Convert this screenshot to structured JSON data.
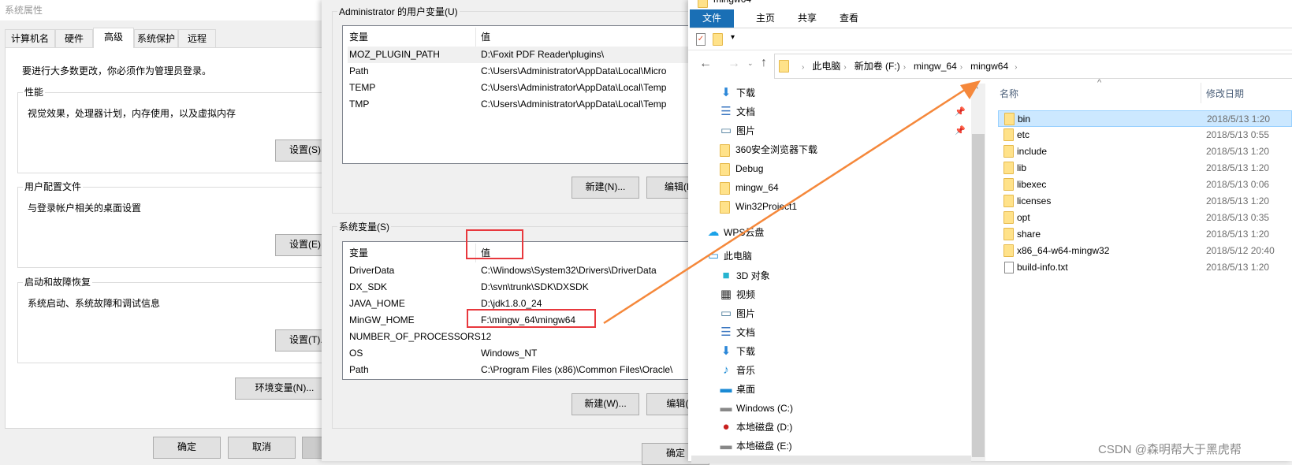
{
  "sys_props": {
    "title": "系统属性",
    "tabs": [
      {
        "label": "计算机名"
      },
      {
        "label": "硬件"
      },
      {
        "label": "高级",
        "active": true
      },
      {
        "label": "系统保护"
      },
      {
        "label": "远程"
      }
    ],
    "admin_note": "要进行大多数更改，你必须作为管理员登录。",
    "groups": [
      {
        "title": "性能",
        "desc": "视觉效果，处理器计划，内存使用，以及虚拟内存",
        "button": "设置(S)..."
      },
      {
        "title": "用户配置文件",
        "desc": "与登录帐户相关的桌面设置",
        "button": "设置(E)..."
      },
      {
        "title": "启动和故障恢复",
        "desc": "系统启动、系统故障和调试信息",
        "button": "设置(T)..."
      }
    ],
    "env_button": "环境变量(N)...",
    "ok": "确定",
    "cancel": "取消"
  },
  "env_vars": {
    "user_group": "Administrator 的用户变量(U)",
    "col_var": "变量",
    "col_val": "值",
    "user_rows": [
      {
        "name": "MOZ_PLUGIN_PATH",
        "value": "D:\\Foxit PDF Reader\\plugins\\"
      },
      {
        "name": "Path",
        "value": "C:\\Users\\Administrator\\AppData\\Local\\Micro"
      },
      {
        "name": "TEMP",
        "value": "C:\\Users\\Administrator\\AppData\\Local\\Temp"
      },
      {
        "name": "TMP",
        "value": "C:\\Users\\Administrator\\AppData\\Local\\Temp"
      }
    ],
    "user_new": "新建(N)...",
    "user_edit": "编辑(E)",
    "sys_group": "系统变量(S)",
    "sys_rows": [
      {
        "name": "DriverData",
        "value": "C:\\Windows\\System32\\Drivers\\DriverData"
      },
      {
        "name": "DX_SDK",
        "value": "D:\\svn\\trunk\\SDK\\DXSDK"
      },
      {
        "name": "JAVA_HOME",
        "value": "D:\\jdk1.8.0_24"
      },
      {
        "name": "MinGW_HOME",
        "value": "F:\\mingw_64\\mingw64"
      },
      {
        "name": "NUMBER_OF_PROCESSORS",
        "value": "12"
      },
      {
        "name": "OS",
        "value": "Windows_NT"
      },
      {
        "name": "Path",
        "value": "C:\\Program Files (x86)\\Common Files\\Oracle\\"
      }
    ],
    "sys_new": "新建(W)...",
    "sys_edit": "编辑(I)",
    "ok": "确定",
    "highlight_color": "#e8383d",
    "arrow_color": "#f5883b"
  },
  "explorer": {
    "title": "mingw64",
    "ribbon_tabs": [
      "文件",
      "主页",
      "共享",
      "查看"
    ],
    "accent": "#1a6fb5",
    "breadcrumb": [
      "此电脑",
      "新加卷 (F:)",
      "mingw_64",
      "mingw64"
    ],
    "nav": [
      {
        "label": "下载",
        "icon": "download-icon"
      },
      {
        "label": "文档",
        "icon": "document-icon",
        "pinned": true
      },
      {
        "label": "图片",
        "icon": "picture-icon",
        "pinned": true
      },
      {
        "label": "360安全浏览器下载",
        "icon": "folder-icon"
      },
      {
        "label": "Debug",
        "icon": "folder-icon"
      },
      {
        "label": "mingw_64",
        "icon": "folder-icon"
      },
      {
        "label": "Win32Project1",
        "icon": "folder-icon"
      },
      {
        "label": "WPS云盘",
        "icon": "cloud-icon"
      },
      {
        "label": "此电脑",
        "icon": "computer-icon"
      },
      {
        "label": "3D 对象",
        "icon": "cube-icon"
      },
      {
        "label": "视频",
        "icon": "video-icon"
      },
      {
        "label": "图片",
        "icon": "picture-icon"
      },
      {
        "label": "文档",
        "icon": "document-icon"
      },
      {
        "label": "下载",
        "icon": "download-icon"
      },
      {
        "label": "音乐",
        "icon": "music-icon"
      },
      {
        "label": "桌面",
        "icon": "desktop-icon"
      },
      {
        "label": "Windows (C:)",
        "icon": "drive-icon"
      },
      {
        "label": "本地磁盘 (D:)",
        "icon": "drive-warning-icon"
      },
      {
        "label": "本地磁盘 (E:)",
        "icon": "drive-icon"
      }
    ],
    "col_name": "名称",
    "col_date": "修改日期",
    "files": [
      {
        "name": "bin",
        "date": "2018/5/13 1:20",
        "type": "folder",
        "selected": true
      },
      {
        "name": "etc",
        "date": "2018/5/13 0:55",
        "type": "folder"
      },
      {
        "name": "include",
        "date": "2018/5/13 1:20",
        "type": "folder"
      },
      {
        "name": "lib",
        "date": "2018/5/13 1:20",
        "type": "folder"
      },
      {
        "name": "libexec",
        "date": "2018/5/13 0:06",
        "type": "folder"
      },
      {
        "name": "licenses",
        "date": "2018/5/13 1:20",
        "type": "folder"
      },
      {
        "name": "opt",
        "date": "2018/5/13 0:35",
        "type": "folder"
      },
      {
        "name": "share",
        "date": "2018/5/13 1:20",
        "type": "folder"
      },
      {
        "name": "x86_64-w64-mingw32",
        "date": "2018/5/12 20:40",
        "type": "folder"
      },
      {
        "name": "build-info.txt",
        "date": "2018/5/13 1:20",
        "type": "file"
      }
    ]
  },
  "watermark": "CSDN @森明帮大于黑虎帮"
}
